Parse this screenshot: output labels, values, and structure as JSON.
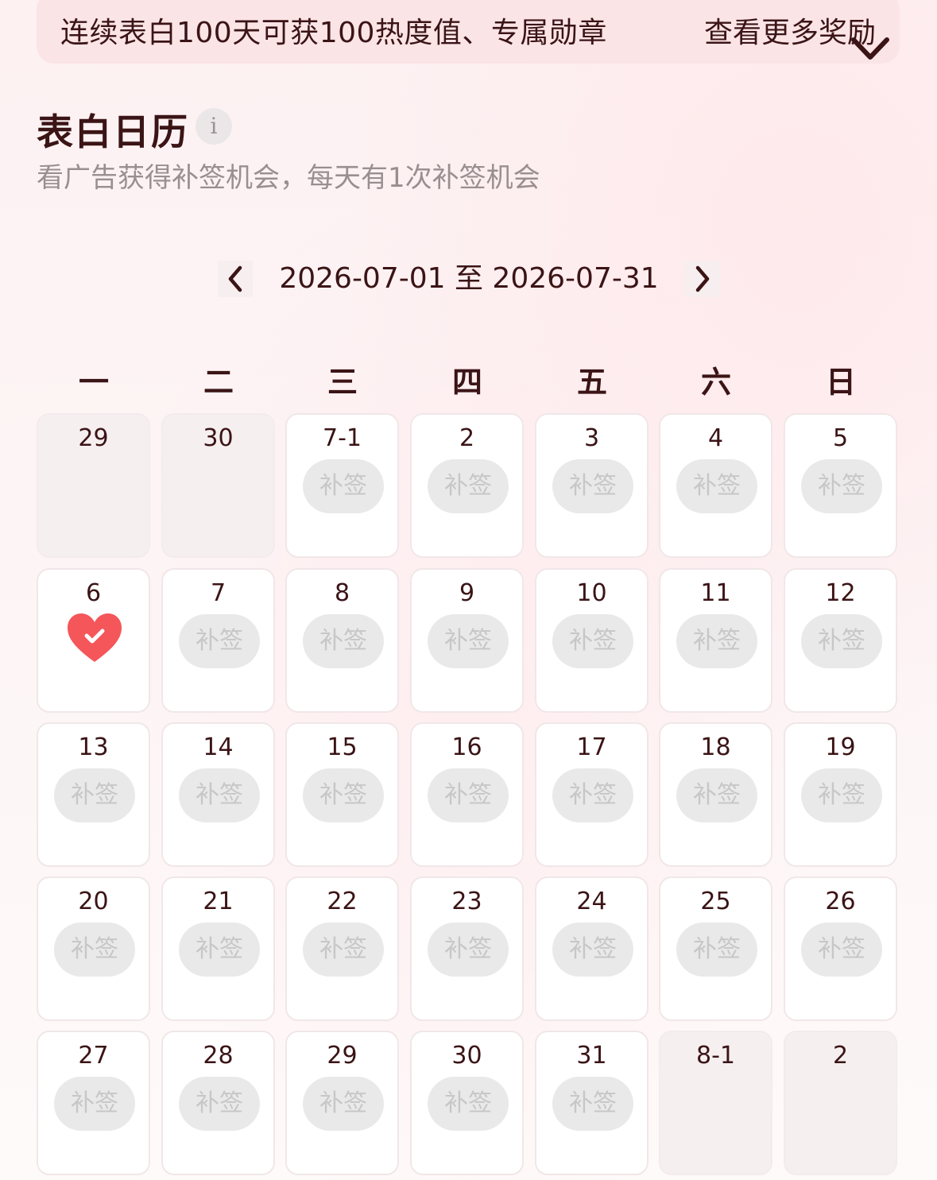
{
  "banner": {
    "text": "连续表白100天可获100热度值、专属勋章",
    "more_label": "查看更多奖励",
    "icon": "chevron-down-icon"
  },
  "header": {
    "title": "表白日历",
    "info_icon_glyph": "i",
    "subtitle": "看广告获得补签机会，每天有1次补签机会"
  },
  "range": {
    "text": "2026-07-01 至 2026-07-31"
  },
  "weekdays": [
    "一",
    "二",
    "三",
    "四",
    "五",
    "六",
    "日"
  ],
  "makeup_label": "补签",
  "colors": {
    "text": "#3b1416",
    "heart": "#f4565a",
    "pill": "#e9e9e9"
  },
  "days": [
    {
      "label": "29",
      "state": "out"
    },
    {
      "label": "30",
      "state": "out"
    },
    {
      "label": "7-1",
      "state": "makeup"
    },
    {
      "label": "2",
      "state": "makeup"
    },
    {
      "label": "3",
      "state": "makeup"
    },
    {
      "label": "4",
      "state": "makeup"
    },
    {
      "label": "5",
      "state": "makeup"
    },
    {
      "label": "6",
      "state": "checked"
    },
    {
      "label": "7",
      "state": "makeup"
    },
    {
      "label": "8",
      "state": "makeup"
    },
    {
      "label": "9",
      "state": "makeup"
    },
    {
      "label": "10",
      "state": "makeup"
    },
    {
      "label": "11",
      "state": "makeup"
    },
    {
      "label": "12",
      "state": "makeup"
    },
    {
      "label": "13",
      "state": "makeup"
    },
    {
      "label": "14",
      "state": "makeup"
    },
    {
      "label": "15",
      "state": "makeup"
    },
    {
      "label": "16",
      "state": "makeup"
    },
    {
      "label": "17",
      "state": "makeup"
    },
    {
      "label": "18",
      "state": "makeup"
    },
    {
      "label": "19",
      "state": "makeup"
    },
    {
      "label": "20",
      "state": "makeup"
    },
    {
      "label": "21",
      "state": "makeup"
    },
    {
      "label": "22",
      "state": "makeup"
    },
    {
      "label": "23",
      "state": "makeup"
    },
    {
      "label": "24",
      "state": "makeup"
    },
    {
      "label": "25",
      "state": "makeup"
    },
    {
      "label": "26",
      "state": "makeup"
    },
    {
      "label": "27",
      "state": "makeup"
    },
    {
      "label": "28",
      "state": "makeup"
    },
    {
      "label": "29",
      "state": "makeup"
    },
    {
      "label": "30",
      "state": "makeup"
    },
    {
      "label": "31",
      "state": "makeup"
    },
    {
      "label": "8-1",
      "state": "out"
    },
    {
      "label": "2",
      "state": "out"
    }
  ]
}
